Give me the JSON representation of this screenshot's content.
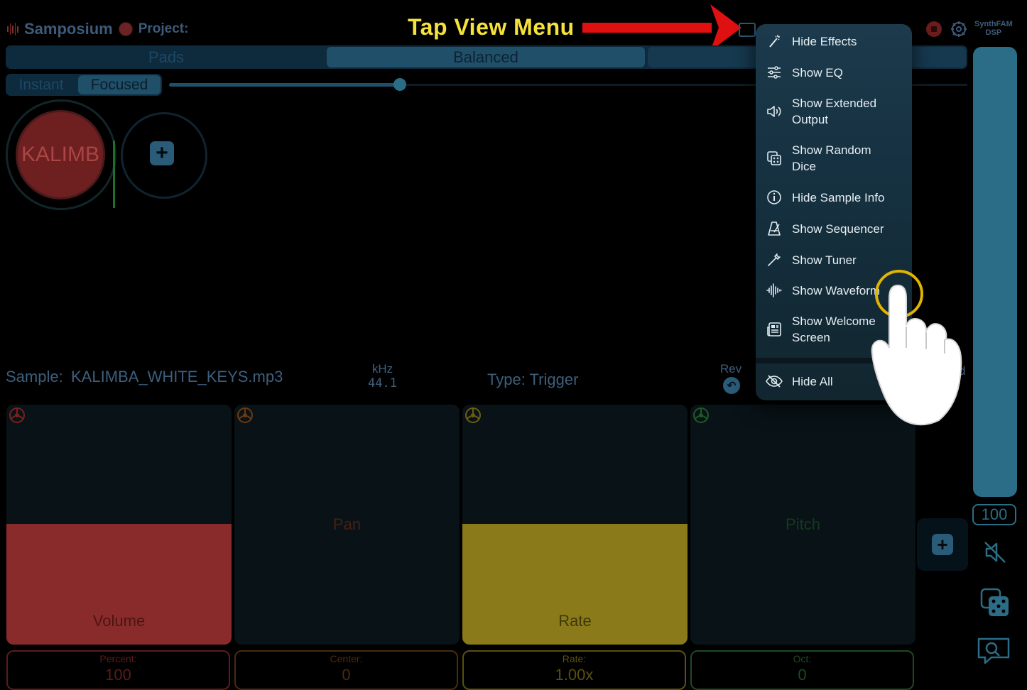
{
  "header": {
    "app_title": "Samposium",
    "project_label": "Project:",
    "brand_line1": "SynthFAM",
    "brand_line2": "DSP"
  },
  "annotation": {
    "tip": "Tap View Menu"
  },
  "mode_tabs": [
    "Pads",
    "Balanced",
    ""
  ],
  "trigger_modes": [
    "Instant",
    "Focused"
  ],
  "mix_slider_value": 0.34,
  "pads": [
    {
      "label": "KALIMB",
      "color": "#6e1f1f"
    }
  ],
  "sample": {
    "label": "Sample:",
    "name": "KALIMBA_WHITE_KEYS.mp3",
    "khz_label": "kHz",
    "khz_value": "44.1",
    "type": "Type: Trigger",
    "rev_label": "Rev",
    "hidden_suffix": "d"
  },
  "controls": [
    {
      "name": "Volume",
      "value_label": "Percent:",
      "value": "100",
      "color": "#8a2b2b",
      "fill_fraction": 0.5
    },
    {
      "name": "Pan",
      "value_label": "Center:",
      "value": "0",
      "color": "#4a2010",
      "fill_fraction": 0
    },
    {
      "name": "Rate",
      "value_label": "Rate:",
      "value": "1.00x",
      "color": "#8a7a1a",
      "fill_fraction": 0.5
    },
    {
      "name": "Pitch",
      "value_label": "Oct:",
      "value": "0",
      "color": "#1e4a22",
      "fill_fraction": 0
    }
  ],
  "master_volume": {
    "value": "100"
  },
  "view_menu": {
    "items": [
      {
        "label": "Hide Effects",
        "icon": "wand-icon"
      },
      {
        "label": "Show EQ",
        "icon": "sliders-icon"
      },
      {
        "label": "Show Extended Output",
        "icon": "speaker-icon"
      },
      {
        "label": "Show Random Dice",
        "icon": "dice-icon"
      },
      {
        "label": "Hide Sample Info",
        "icon": "info-icon"
      },
      {
        "label": "Show Sequencer",
        "icon": "metronome-icon"
      },
      {
        "label": "Show Tuner",
        "icon": "tuning-fork-icon"
      },
      {
        "label": "Show Waveform",
        "icon": "waveform-icon"
      },
      {
        "label": "Show Welcome Screen",
        "icon": "newspaper-icon"
      },
      {
        "label": "Hide All",
        "icon": "eye-slash-icon"
      }
    ]
  },
  "colors": {
    "accent": "#2b6d86",
    "tip_text": "#f5e23a",
    "arrow": "#e01010"
  }
}
